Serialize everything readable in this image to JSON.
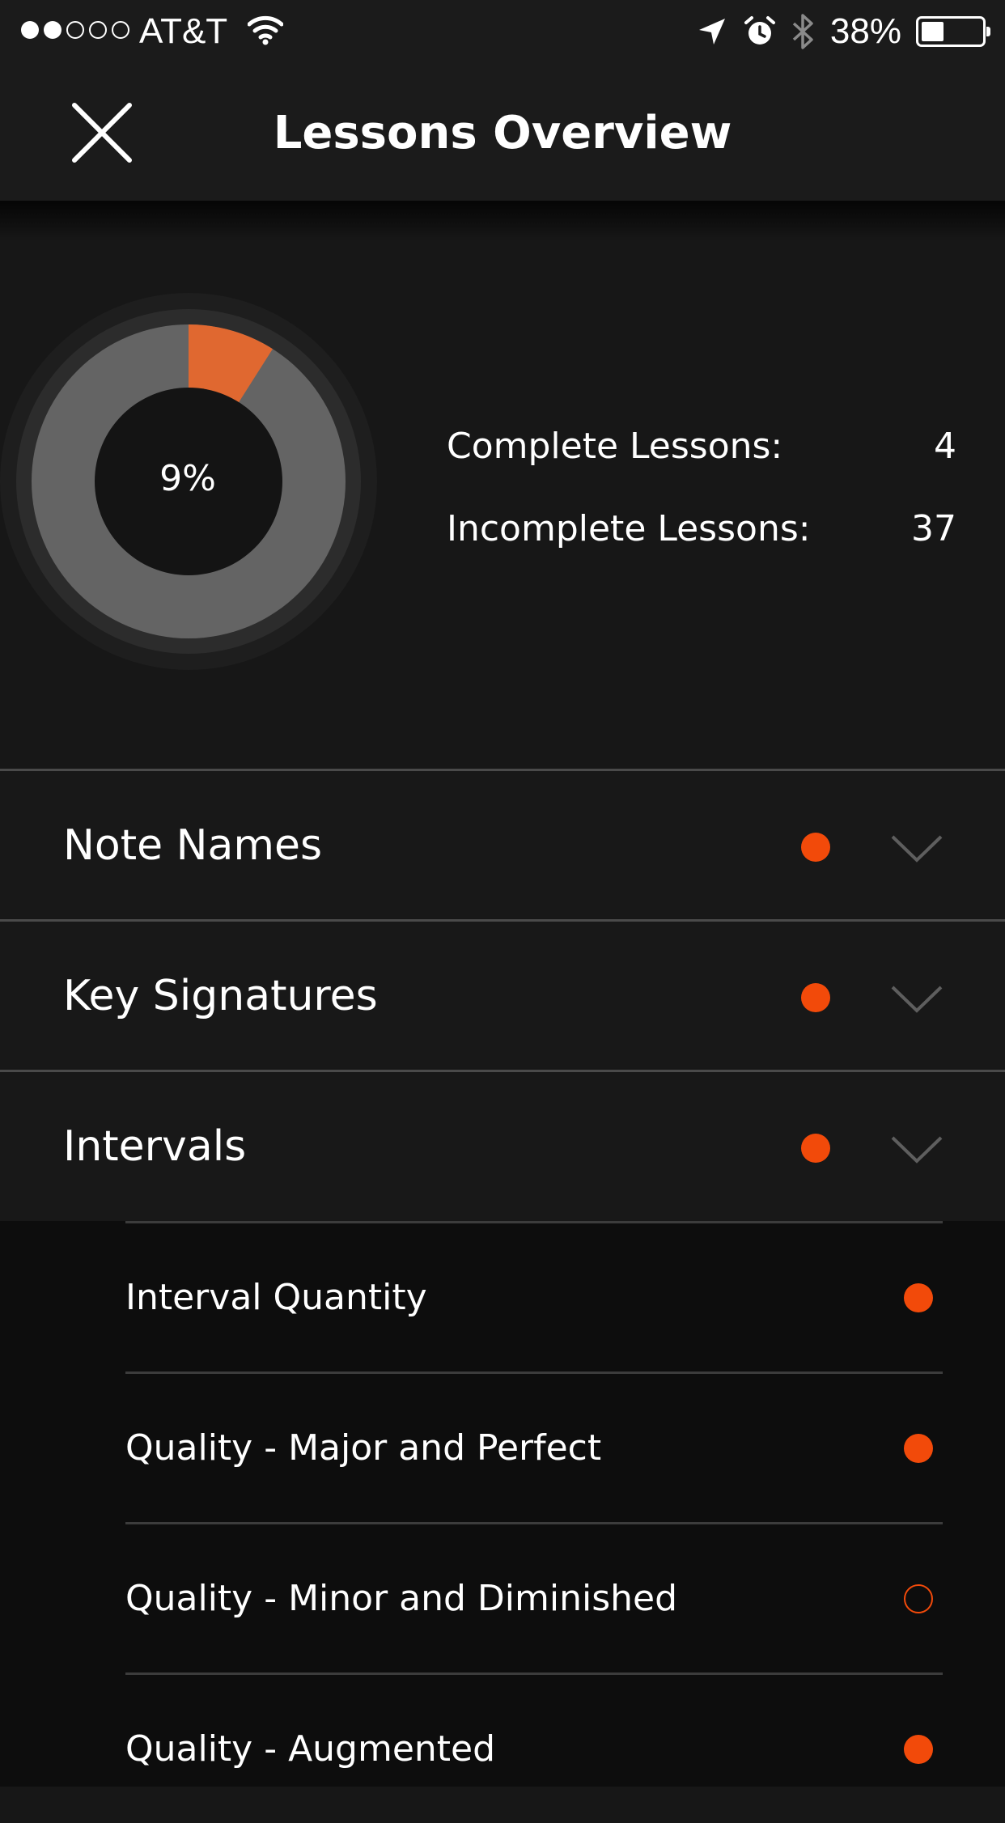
{
  "status_bar": {
    "signal_dots_full": 2,
    "signal_dots_total": 5,
    "carrier": "AT&T",
    "battery_percent": "38%",
    "battery_level": 0.38,
    "icons": [
      "signal-dots-icon",
      "wifi-icon",
      "location-arrow-icon",
      "alarm-icon",
      "bluetooth-icon",
      "battery-icon"
    ]
  },
  "header": {
    "title": "Lessons Overview",
    "close_icon": "close-icon"
  },
  "overview": {
    "progress_label": "9%",
    "progress_fraction": 0.09,
    "stats": [
      {
        "label": "Complete Lessons:",
        "value": "4"
      },
      {
        "label": "Incomplete Lessons:",
        "value": "37"
      }
    ]
  },
  "sections": [
    {
      "label": "Note Names",
      "status": "in-progress",
      "expanded": false
    },
    {
      "label": "Key Signatures",
      "status": "in-progress",
      "expanded": false
    },
    {
      "label": "Intervals",
      "status": "in-progress",
      "expanded": true
    }
  ],
  "intervals_lessons": [
    {
      "label": "Interval Quantity",
      "status": "complete"
    },
    {
      "label": "Quality - Major and Perfect",
      "status": "complete"
    },
    {
      "label": "Quality - Minor and Diminished",
      "status": "incomplete"
    },
    {
      "label": "Quality - Augmented",
      "status": "complete"
    }
  ],
  "colors": {
    "accent": "#f24a0a",
    "progress_fill": "#e06830",
    "ring_track": "#646464",
    "background": "#171717"
  }
}
